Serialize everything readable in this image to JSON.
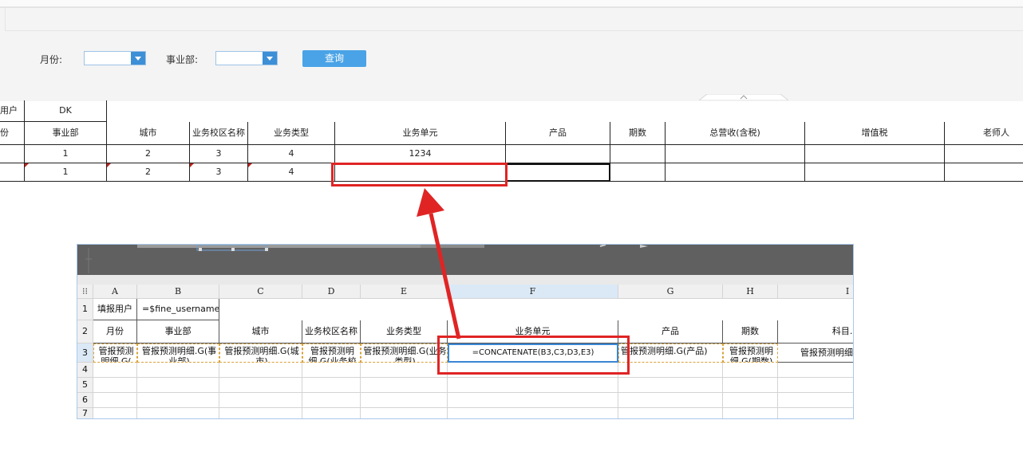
{
  "filter": {
    "month_label": "月份:",
    "division_label": "事业部:",
    "query_button": "查询",
    "month_value": "",
    "division_value": ""
  },
  "report": {
    "user_label": "填报用户",
    "user_value": "DK",
    "headers": [
      "月份",
      "事业部",
      "城市",
      "业务校区名称",
      "业务类型",
      "业务单元",
      "产品",
      "期数",
      "总营收(含税)",
      "增值税",
      "老师人"
    ],
    "row1": [
      "",
      "1",
      "2",
      "3",
      "4",
      "1234",
      "",
      "",
      "",
      "",
      ""
    ],
    "row2": [
      "",
      "1",
      "2",
      "3",
      "4",
      "",
      "",
      "",
      "",
      "",
      ""
    ]
  },
  "designer": {
    "col_letters": [
      "A",
      "B",
      "C",
      "D",
      "E",
      "F",
      "G",
      "H",
      "I"
    ],
    "row_numbers": [
      "1",
      "2",
      "3",
      "4",
      "5",
      "6",
      "7"
    ],
    "r1": {
      "a": "填报用户",
      "b": "=$fine_username"
    },
    "r2": [
      "月份",
      "事业部",
      "城市",
      "业务校区名称",
      "业务类型",
      "业务单元",
      "产品",
      "期数",
      "科目.G("
    ],
    "r3": [
      "管报预测明细.G(",
      "管报预测明细.G(事业部)",
      "管报预测明细.G(城市)",
      "管报预测明细.G(业务校",
      "管报预测明细.G(业务类型)",
      "=CONCATENATE(B3,C3,D3,E3)",
      "管报预测明细.G(产品)",
      "管报预测明细.G(期数)",
      "管报预测明细"
    ]
  },
  "colors": {
    "accent": "#4aa3e6",
    "highlight": "#e02424",
    "combo_arrow": "#3d8fd6"
  }
}
